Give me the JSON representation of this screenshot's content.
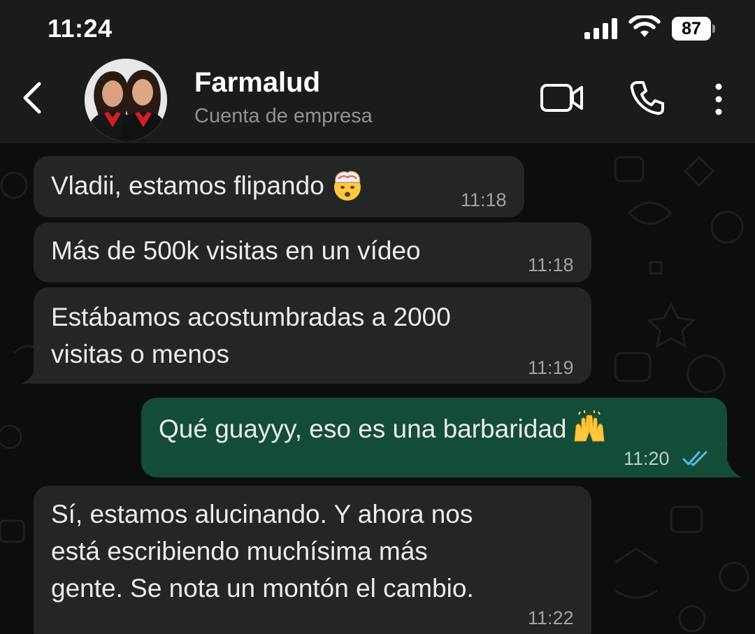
{
  "status_bar": {
    "time": "11:24",
    "battery": "87"
  },
  "header": {
    "contact_name": "Farmalud",
    "contact_subtitle": "Cuenta de empresa"
  },
  "messages": [
    {
      "direction": "in",
      "text": "Vladii, estamos flipando",
      "emoji": "exploding-head",
      "time": "11:18"
    },
    {
      "direction": "in",
      "text": "Más de 500k visitas en un vídeo",
      "time": "11:18"
    },
    {
      "direction": "in",
      "text_line1": "Estábamos acostumbradas a 2000",
      "text_line2": "visitas o menos",
      "time": "11:19"
    },
    {
      "direction": "out",
      "text": "Qué guayyy, eso es una barbaridad",
      "emoji": "raising-hands",
      "time": "11:20",
      "status": "read"
    },
    {
      "direction": "in",
      "text_line1": "Sí, estamos alucinando. Y ahora nos",
      "text_line2": "está escribiendo muchísima más",
      "text_line3": "gente. Se nota un montón el cambio.",
      "time": "11:22"
    }
  ],
  "colors": {
    "header_bg": "#1b1b1b",
    "chat_bg": "#0c0d0d",
    "incoming_bubble": "#242626",
    "outgoing_bubble": "#144d37",
    "read_ticks": "#53bdeb"
  }
}
